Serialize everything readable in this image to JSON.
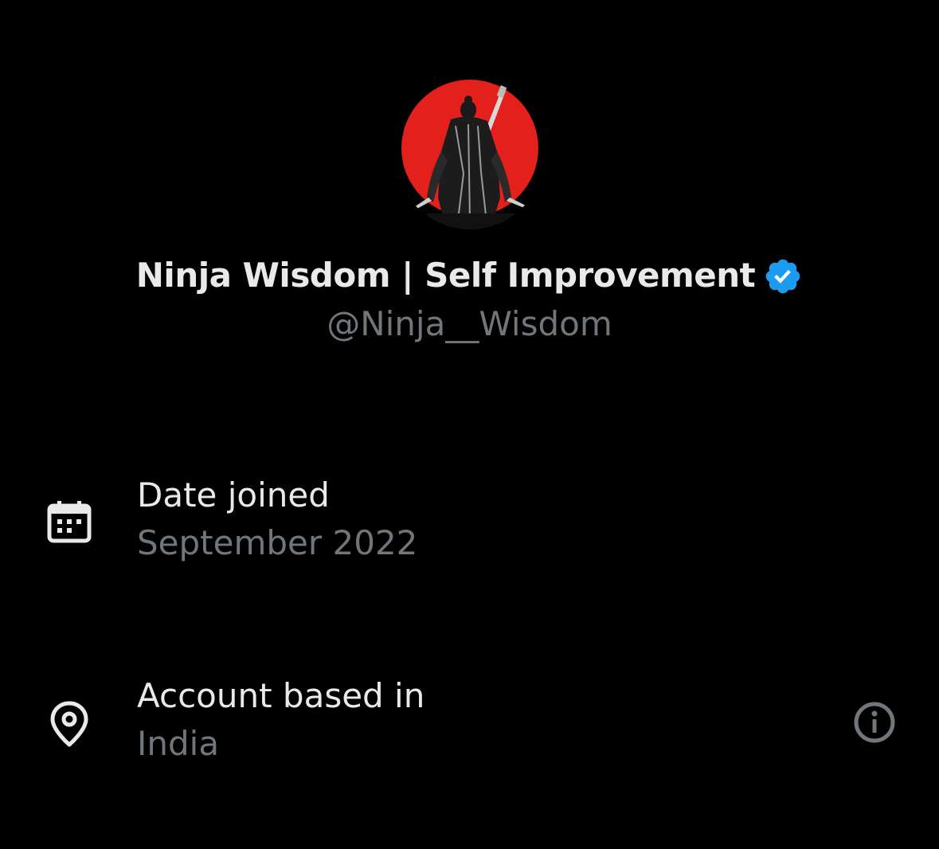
{
  "profile": {
    "display_name": "Ninja Wisdom | Self Improvement",
    "handle": "@Ninja__Wisdom",
    "verified": true,
    "avatar_icon": "ninja-avatar-image"
  },
  "about": {
    "date_joined": {
      "icon": "calendar-icon",
      "label": "Date joined",
      "value": "September 2022"
    },
    "location": {
      "icon": "location-pin-icon",
      "label": "Account based in",
      "value": "India",
      "info_icon": "info-icon"
    }
  },
  "colors": {
    "background": "#000000",
    "primary_text": "#e7e9ea",
    "secondary_text": "#71767b",
    "verified_blue": "#1d9bf0",
    "avatar_red": "#e3201b"
  }
}
